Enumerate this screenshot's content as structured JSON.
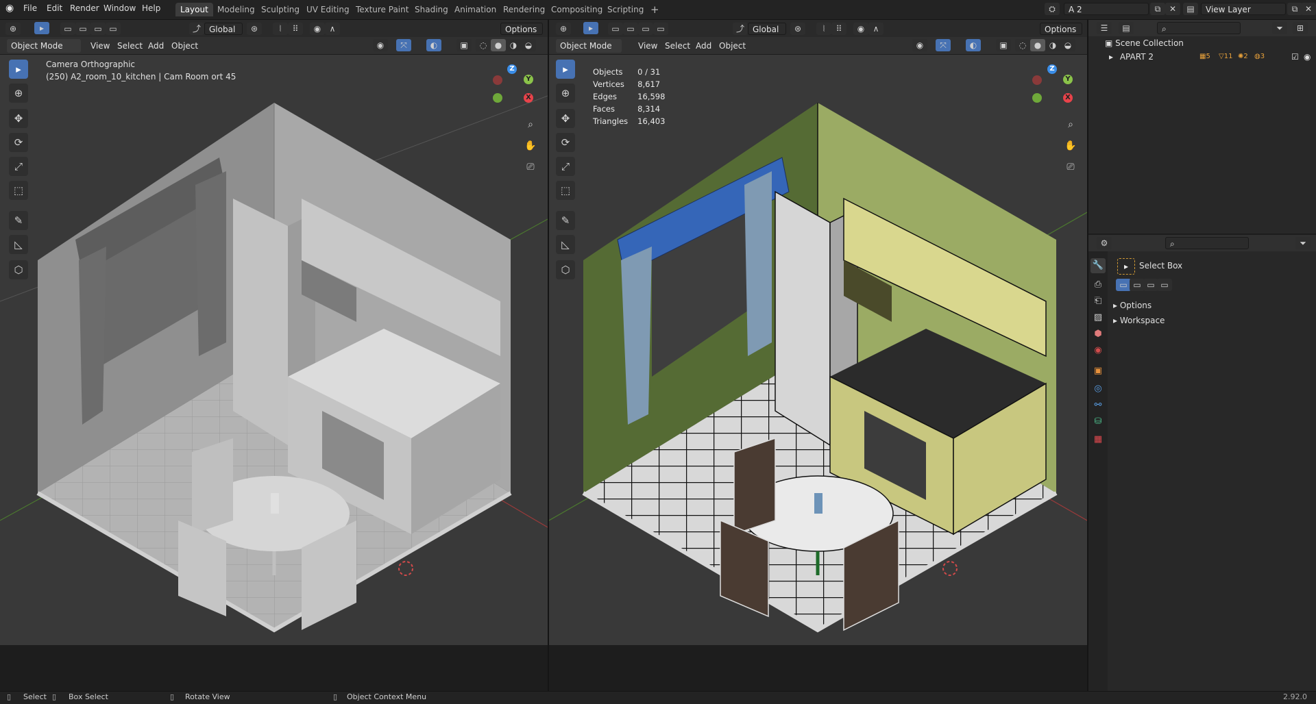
{
  "topbar": {
    "menus": [
      "File",
      "Edit",
      "Render",
      "Window",
      "Help"
    ],
    "workspaces": [
      "Layout",
      "Modeling",
      "Sculpting",
      "UV Editing",
      "Texture Paint",
      "Shading",
      "Animation",
      "Rendering",
      "Compositing",
      "Scripting"
    ],
    "active_workspace": "Layout",
    "add_tab": "+",
    "scene_name": "A 2",
    "view_layer": "View Layer"
  },
  "viewport_left": {
    "mode": "Object Mode",
    "menus": [
      "View",
      "Select",
      "Add",
      "Object"
    ],
    "orientation": "Global",
    "options_label": "Options",
    "camera_label": "Camera Orthographic",
    "object_label": "(250) A2_room_10_kitchen | Cam Room ort 45"
  },
  "viewport_right": {
    "mode": "Object Mode",
    "menus": [
      "View",
      "Select",
      "Add",
      "Object"
    ],
    "orientation": "Global",
    "options_label": "Options",
    "stats": [
      {
        "label": "Objects",
        "value": "0 / 31"
      },
      {
        "label": "Vertices",
        "value": "8,617"
      },
      {
        "label": "Edges",
        "value": "16,598"
      },
      {
        "label": "Faces",
        "value": "8,314"
      },
      {
        "label": "Triangles",
        "value": "16,403"
      }
    ]
  },
  "gizmo": {
    "x": "X",
    "y": "Y",
    "z": "Z"
  },
  "outliner": {
    "root": "Scene Collection",
    "item": "APART 2",
    "badges": [
      "5",
      "11",
      "2",
      "3"
    ]
  },
  "properties": {
    "tool_name": "Select Box",
    "panels": [
      "Options",
      "Workspace"
    ]
  },
  "statusbar": {
    "select": "Select",
    "box_select": "Box Select",
    "rotate": "Rotate View",
    "context": "Object Context Menu",
    "version": "2.92.0"
  },
  "colors": {
    "accent": "#4772b3",
    "x_axis": "#e8434a",
    "y_axis": "#8bc34a",
    "z_axis": "#3b8ee8",
    "wall_green": "#9bab64",
    "curtain_blue": "#3566b8"
  }
}
